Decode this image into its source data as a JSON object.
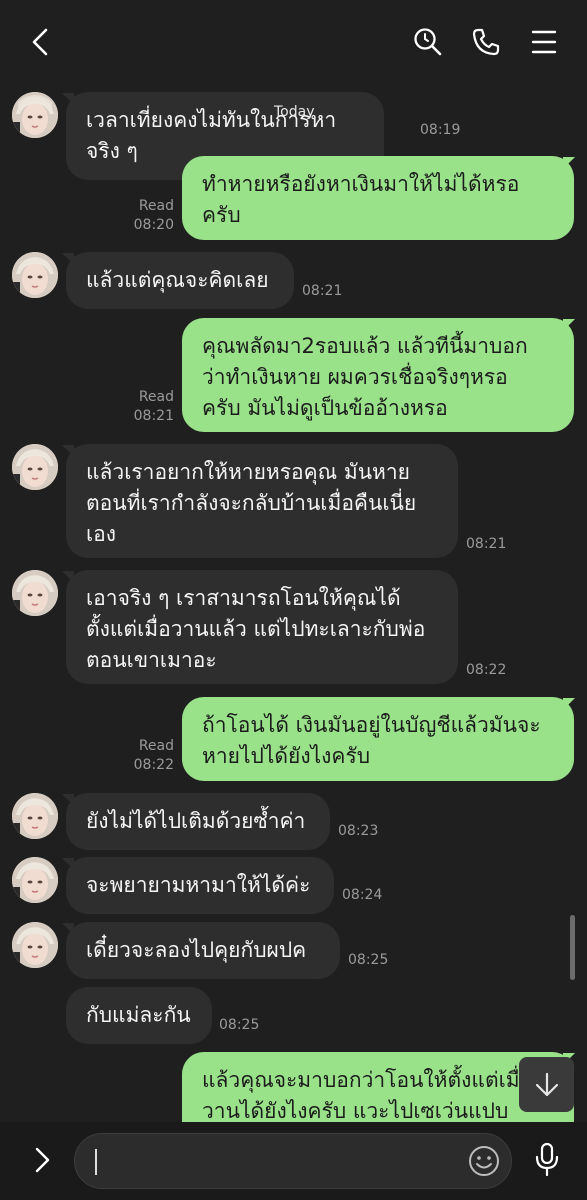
{
  "header": {
    "back_icon": "chevron-left-icon",
    "search_icon": "search-icon",
    "call_icon": "phone-icon",
    "menu_icon": "hamburger-menu-icon"
  },
  "date_divider": "Today",
  "messages": [
    {
      "side": "in",
      "text": "เวลาเที่ยงคงไม่ทันในการหาจริง ๆ",
      "time": "08:19"
    },
    {
      "side": "out",
      "text": "ทำหายหรือยังหาเงินมาให้ไม่ได้หรอ\nครับ",
      "status": "Read",
      "time": "08:20"
    },
    {
      "side": "in",
      "text": "แล้วแต่คุณจะคิดเลย",
      "time": "08:21"
    },
    {
      "side": "out",
      "text": "คุณพลัดมา2รอบแล้ว แล้วทีนี้มาบอก\nว่าทำเงินหาย ผมควรเชื่อจริงๆหรอ\nครับ มันไม่ดูเป็นข้ออ้างหรอ",
      "status": "Read",
      "time": "08:21"
    },
    {
      "side": "in",
      "text": "แล้วเราอยากให้หายหรอคุณ มันหาย\nตอนที่เรากำลังจะกลับบ้านเมื่อคืนเนี่ย\nเอง",
      "time": "08:21"
    },
    {
      "side": "in",
      "text": "เอาจริง ๆ เราสามารถโอนให้คุณได้\nตั้งแต่เมื่อวานแล้ว แต่ไปทะเลาะกับพ่อ\nตอนเขาเมาอะ",
      "time": "08:22"
    },
    {
      "side": "out",
      "text": "ถ้าโอนได้ เงินมันอยู่ในบัญชีแล้วมันจะ\nหายไปได้ยังไงครับ",
      "status": "Read",
      "time": "08:22"
    },
    {
      "side": "in",
      "text": "ยังไม่ได้ไปเติมด้วยซ้ำค่า",
      "time": "08:23"
    },
    {
      "side": "in",
      "text": "จะพยายามหามาให้ได้ค่ะ",
      "time": "08:24"
    },
    {
      "side": "in",
      "text": "เดี๋ยวจะลองไปคุยกับผปค",
      "time": "08:25"
    },
    {
      "side": "in",
      "text": "กับแม่ละกัน",
      "time": "08:25"
    },
    {
      "side": "out",
      "text": "แล้วคุณจะมาบอกว่าโอนให้ตั้งแต่เมื่อ\nวานได้ยังไงครับ แวะไปเซเว่นแปบ",
      "status": "",
      "time": ""
    }
  ],
  "scroll_down_icon": "arrow-down-icon",
  "footer": {
    "expand_icon": "chevron-right-icon",
    "input_value": "",
    "input_placeholder": "",
    "emoji_icon": "smiley-icon",
    "mic_icon": "microphone-icon"
  },
  "colors": {
    "background": "#1f1f1f",
    "incoming_bubble": "#2e2e2e",
    "outgoing_bubble": "#99e28a",
    "timestamp": "#9a9a9a"
  }
}
